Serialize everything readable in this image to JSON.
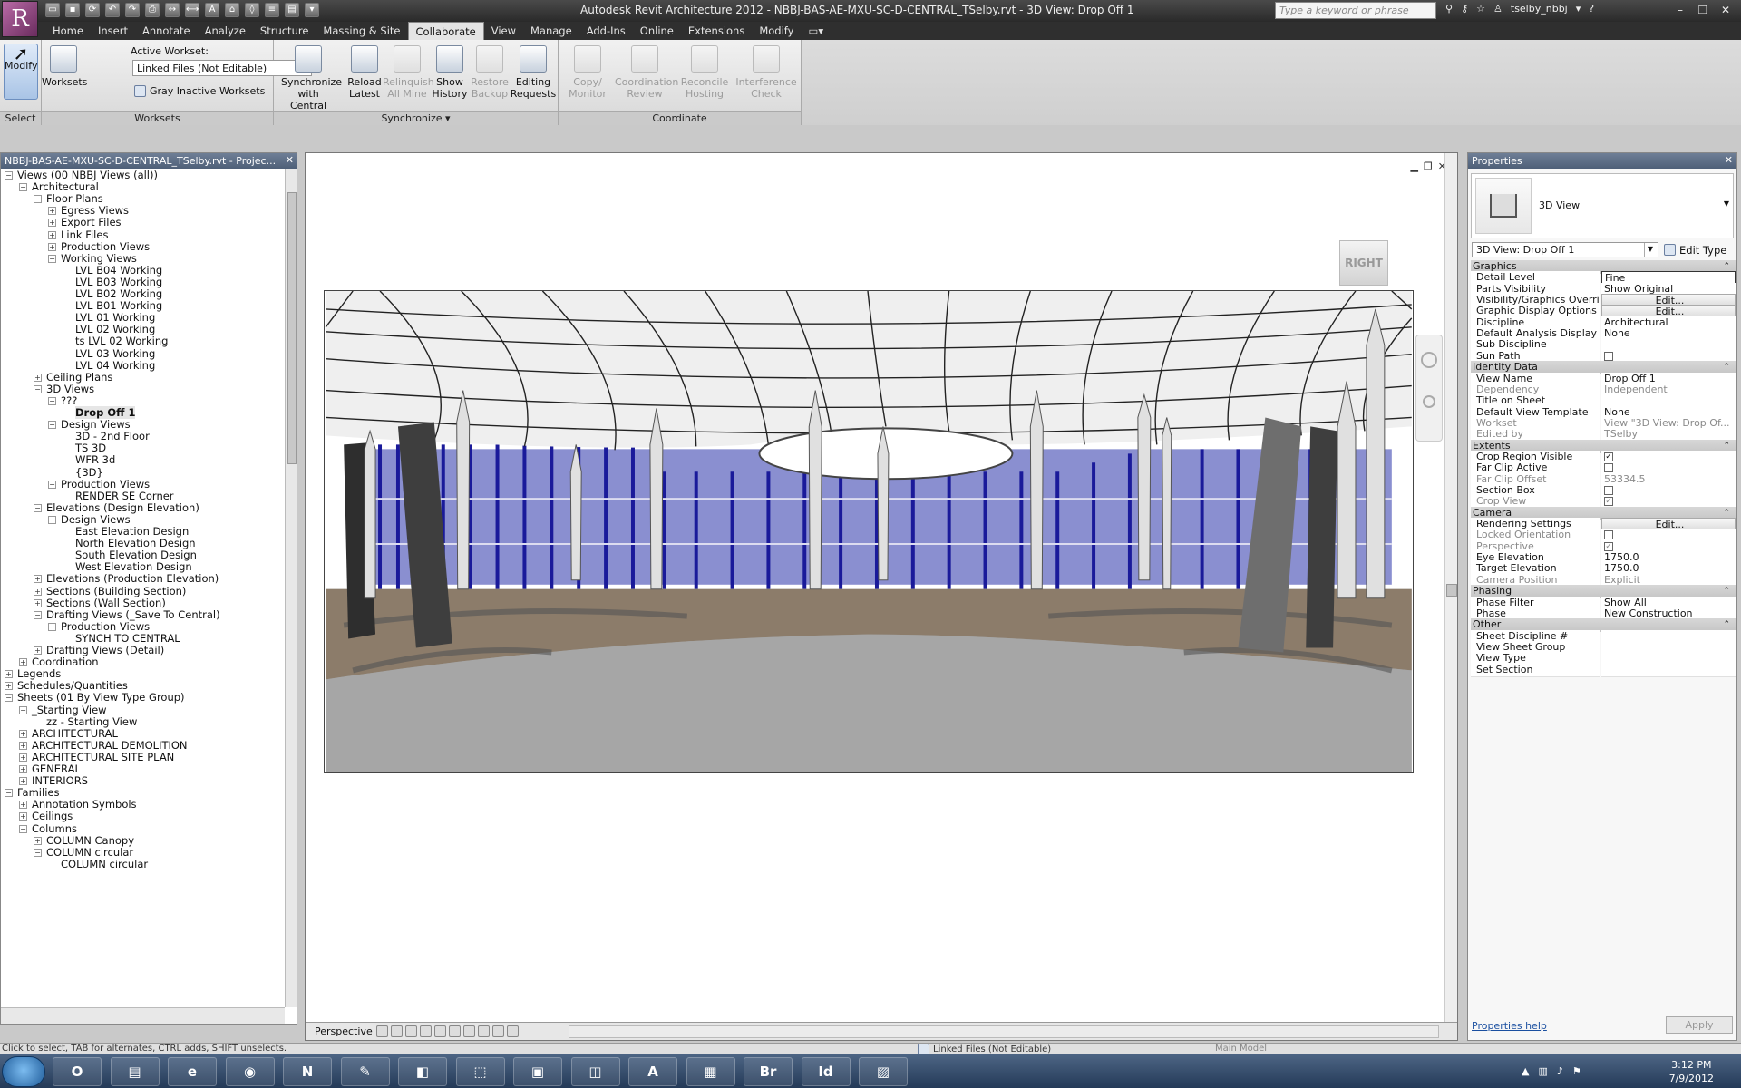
{
  "app": {
    "logo": "R",
    "title": "Autodesk Revit Architecture 2012 -    NBBJ-BAS-AE-MXU-SC-D-CENTRAL_TSelby.rvt - 3D View: Drop Off 1",
    "search_placeholder": "Type a keyword or phrase",
    "user": "tselby_nbbj"
  },
  "tabs": [
    "Home",
    "Insert",
    "Annotate",
    "Analyze",
    "Structure",
    "Massing & Site",
    "Collaborate",
    "View",
    "Manage",
    "Add-Ins",
    "Online",
    "Extensions",
    "Modify"
  ],
  "ribbon": {
    "select": {
      "modify": "Modify",
      "panel": "Select"
    },
    "worksets": {
      "button": "Worksets",
      "active_label": "Active Workset:",
      "active_value": "Linked Files (Not Editable)",
      "gray_inactive": "Gray Inactive Worksets",
      "panel": "Worksets"
    },
    "synchronize": {
      "buttons": [
        {
          "l1": "Synchronize",
          "l2": "with Central"
        },
        {
          "l1": "Reload",
          "l2": "Latest"
        },
        {
          "l1": "Relinquish",
          "l2": "All Mine"
        },
        {
          "l1": "Show",
          "l2": "History"
        },
        {
          "l1": "Restore",
          "l2": "Backup"
        },
        {
          "l1": "Editing",
          "l2": "Requests"
        }
      ],
      "panel": "Synchronize"
    },
    "coordinate": {
      "buttons": [
        {
          "l1": "Copy/",
          "l2": "Monitor"
        },
        {
          "l1": "Coordination",
          "l2": "Review"
        },
        {
          "l1": "Reconcile",
          "l2": "Hosting"
        },
        {
          "l1": "Interference",
          "l2": "Check"
        }
      ],
      "panel": "Coordinate"
    }
  },
  "project_browser": {
    "title": "NBBJ-BAS-AE-MXU-SC-D-CENTRAL_TSelby.rvt - Projec...",
    "items": [
      {
        "label": "Views (00 NBBJ Views (all))",
        "d": 0,
        "t": "-"
      },
      {
        "label": "Architectural",
        "d": 1,
        "t": "-"
      },
      {
        "label": "Floor Plans",
        "d": 2,
        "t": "-"
      },
      {
        "label": "Egress Views",
        "d": 3,
        "t": "+"
      },
      {
        "label": "Export Files",
        "d": 3,
        "t": "+"
      },
      {
        "label": "Link Files",
        "d": 3,
        "t": "+"
      },
      {
        "label": "Production Views",
        "d": 3,
        "t": "+"
      },
      {
        "label": "Working Views",
        "d": 3,
        "t": "-"
      },
      {
        "label": "LVL B04 Working",
        "d": 4,
        "t": ""
      },
      {
        "label": "LVL B03 Working",
        "d": 4,
        "t": ""
      },
      {
        "label": "LVL B02 Working",
        "d": 4,
        "t": ""
      },
      {
        "label": "LVL B01 Working",
        "d": 4,
        "t": ""
      },
      {
        "label": "LVL 01 Working",
        "d": 4,
        "t": ""
      },
      {
        "label": "LVL 02 Working",
        "d": 4,
        "t": ""
      },
      {
        "label": "ts LVL 02 Working",
        "d": 4,
        "t": ""
      },
      {
        "label": "LVL 03 Working",
        "d": 4,
        "t": ""
      },
      {
        "label": "LVL 04 Working",
        "d": 4,
        "t": ""
      },
      {
        "label": "Ceiling Plans",
        "d": 2,
        "t": "+"
      },
      {
        "label": "3D Views",
        "d": 2,
        "t": "-"
      },
      {
        "label": "???",
        "d": 3,
        "t": "-"
      },
      {
        "label": "Drop Off 1",
        "d": 4,
        "t": "",
        "sel": true
      },
      {
        "label": "Design Views",
        "d": 3,
        "t": "-"
      },
      {
        "label": "3D - 2nd Floor",
        "d": 4,
        "t": ""
      },
      {
        "label": "TS 3D",
        "d": 4,
        "t": ""
      },
      {
        "label": "WFR 3d",
        "d": 4,
        "t": ""
      },
      {
        "label": "{3D}",
        "d": 4,
        "t": ""
      },
      {
        "label": "Production Views",
        "d": 3,
        "t": "-"
      },
      {
        "label": "RENDER SE Corner",
        "d": 4,
        "t": ""
      },
      {
        "label": "Elevations (Design Elevation)",
        "d": 2,
        "t": "-"
      },
      {
        "label": "Design Views",
        "d": 3,
        "t": "-"
      },
      {
        "label": "East Elevation Design",
        "d": 4,
        "t": ""
      },
      {
        "label": "North Elevation Design",
        "d": 4,
        "t": ""
      },
      {
        "label": "South Elevation Design",
        "d": 4,
        "t": ""
      },
      {
        "label": "West Elevation Design",
        "d": 4,
        "t": ""
      },
      {
        "label": "Elevations (Production Elevation)",
        "d": 2,
        "t": "+"
      },
      {
        "label": "Sections (Building Section)",
        "d": 2,
        "t": "+"
      },
      {
        "label": "Sections (Wall Section)",
        "d": 2,
        "t": "+"
      },
      {
        "label": "Drafting Views (_Save To Central)",
        "d": 2,
        "t": "-"
      },
      {
        "label": "Production Views",
        "d": 3,
        "t": "-"
      },
      {
        "label": "SYNCH TO CENTRAL",
        "d": 4,
        "t": ""
      },
      {
        "label": "Drafting Views (Detail)",
        "d": 2,
        "t": "+"
      },
      {
        "label": "Coordination",
        "d": 1,
        "t": "+"
      },
      {
        "label": "Legends",
        "d": 0,
        "t": "+"
      },
      {
        "label": "Schedules/Quantities",
        "d": 0,
        "t": "+"
      },
      {
        "label": "Sheets (01 By View Type Group)",
        "d": 0,
        "t": "-"
      },
      {
        "label": "_Starting View",
        "d": 1,
        "t": "-"
      },
      {
        "label": "zz - Starting View",
        "d": 2,
        "t": ""
      },
      {
        "label": "ARCHITECTURAL",
        "d": 1,
        "t": "+"
      },
      {
        "label": "ARCHITECTURAL DEMOLITION",
        "d": 1,
        "t": "+"
      },
      {
        "label": "ARCHITECTURAL SITE PLAN",
        "d": 1,
        "t": "+"
      },
      {
        "label": "GENERAL",
        "d": 1,
        "t": "+"
      },
      {
        "label": "INTERIORS",
        "d": 1,
        "t": "+"
      },
      {
        "label": "Families",
        "d": 0,
        "t": "-"
      },
      {
        "label": "Annotation Symbols",
        "d": 1,
        "t": "+"
      },
      {
        "label": "Ceilings",
        "d": 1,
        "t": "+"
      },
      {
        "label": "Columns",
        "d": 1,
        "t": "-"
      },
      {
        "label": "COLUMN Canopy",
        "d": 2,
        "t": "+"
      },
      {
        "label": "COLUMN circular",
        "d": 2,
        "t": "-"
      },
      {
        "label": "COLUMN circular",
        "d": 3,
        "t": ""
      }
    ]
  },
  "view": {
    "viewcube_face": "RIGHT",
    "view_control": "Perspective"
  },
  "properties": {
    "title": "Properties",
    "type_name": "3D View",
    "instance_selector": "3D View: Drop Off 1",
    "edit_type": "Edit Type",
    "rows": [
      {
        "cat": "Graphics"
      },
      {
        "n": "Detail Level",
        "v": "Fine",
        "k": "fine"
      },
      {
        "n": "Parts Visibility",
        "v": "Show Original"
      },
      {
        "n": "Visibility/Graphics Overrides",
        "v": "Edit...",
        "k": "btn"
      },
      {
        "n": "Graphic Display Options",
        "v": "Edit...",
        "k": "btn"
      },
      {
        "n": "Discipline",
        "v": "Architectural"
      },
      {
        "n": "Default Analysis Display S...",
        "v": "None"
      },
      {
        "n": "Sub Discipline",
        "v": ""
      },
      {
        "n": "Sun Path",
        "v": "",
        "k": "cb"
      },
      {
        "cat": "Identity Data"
      },
      {
        "n": "View Name",
        "v": "Drop Off 1"
      },
      {
        "n": "Dependency",
        "v": "Independent",
        "ro": true
      },
      {
        "n": "Title on Sheet",
        "v": ""
      },
      {
        "n": "Default View Template",
        "v": "None"
      },
      {
        "n": "Workset",
        "v": "View \"3D View: Drop Of...",
        "ro": true
      },
      {
        "n": "Edited by",
        "v": "TSelby",
        "ro": true
      },
      {
        "cat": "Extents"
      },
      {
        "n": "Crop Region Visible",
        "v": "✓",
        "k": "cb"
      },
      {
        "n": "Far Clip Active",
        "v": "",
        "k": "cb"
      },
      {
        "n": "Far Clip Offset",
        "v": "53334.5",
        "ro": true
      },
      {
        "n": "Section Box",
        "v": "",
        "k": "cb"
      },
      {
        "n": "Crop View",
        "v": "✓",
        "k": "cb",
        "ro": true
      },
      {
        "cat": "Camera"
      },
      {
        "n": "Rendering Settings",
        "v": "Edit...",
        "k": "btn"
      },
      {
        "n": "Locked Orientation",
        "v": "",
        "k": "cb",
        "ro": true
      },
      {
        "n": "Perspective",
        "v": "✓",
        "k": "cb",
        "ro": true
      },
      {
        "n": "Eye Elevation",
        "v": "1750.0"
      },
      {
        "n": "Target Elevation",
        "v": "1750.0"
      },
      {
        "n": "Camera Position",
        "v": "Explicit",
        "ro": true
      },
      {
        "cat": "Phasing"
      },
      {
        "n": "Phase Filter",
        "v": "Show All"
      },
      {
        "n": "Phase",
        "v": "New Construction"
      },
      {
        "cat": "Other"
      },
      {
        "n": "Sheet Discipline #",
        "v": ""
      },
      {
        "n": "View Sheet Group",
        "v": ""
      },
      {
        "n": "View Type",
        "v": ""
      },
      {
        "n": "Set Section",
        "v": ""
      }
    ],
    "help": "Properties help",
    "apply": "Apply"
  },
  "status": {
    "left": "Click to select, TAB for alternates, CTRL adds, SHIFT unselects.",
    "workset": "Linked Files (Not Editable)",
    "model": "Main Model"
  },
  "taskbar": {
    "apps": [
      {
        "n": "outlook-icon",
        "t": "O"
      },
      {
        "n": "explorer-icon",
        "t": "▤"
      },
      {
        "n": "ie-icon",
        "t": "e"
      },
      {
        "n": "chrome-icon",
        "t": "◉"
      },
      {
        "n": "3dsmax-icon",
        "t": "N"
      },
      {
        "n": "app-icon-1",
        "t": "✎"
      },
      {
        "n": "app-icon-2",
        "t": "◧"
      },
      {
        "n": "app-icon-3",
        "t": "⬚"
      },
      {
        "n": "app-icon-4",
        "t": "▣"
      },
      {
        "n": "app-icon-5",
        "t": "◫"
      },
      {
        "n": "acrobat-icon",
        "t": "A"
      },
      {
        "n": "app-icon-6",
        "t": "▦"
      },
      {
        "n": "bridge-icon",
        "t": "Br"
      },
      {
        "n": "indesign-icon",
        "t": "Id"
      },
      {
        "n": "app-icon-7",
        "t": "▨"
      }
    ],
    "time": "3:12 PM",
    "date": "7/9/2012"
  }
}
